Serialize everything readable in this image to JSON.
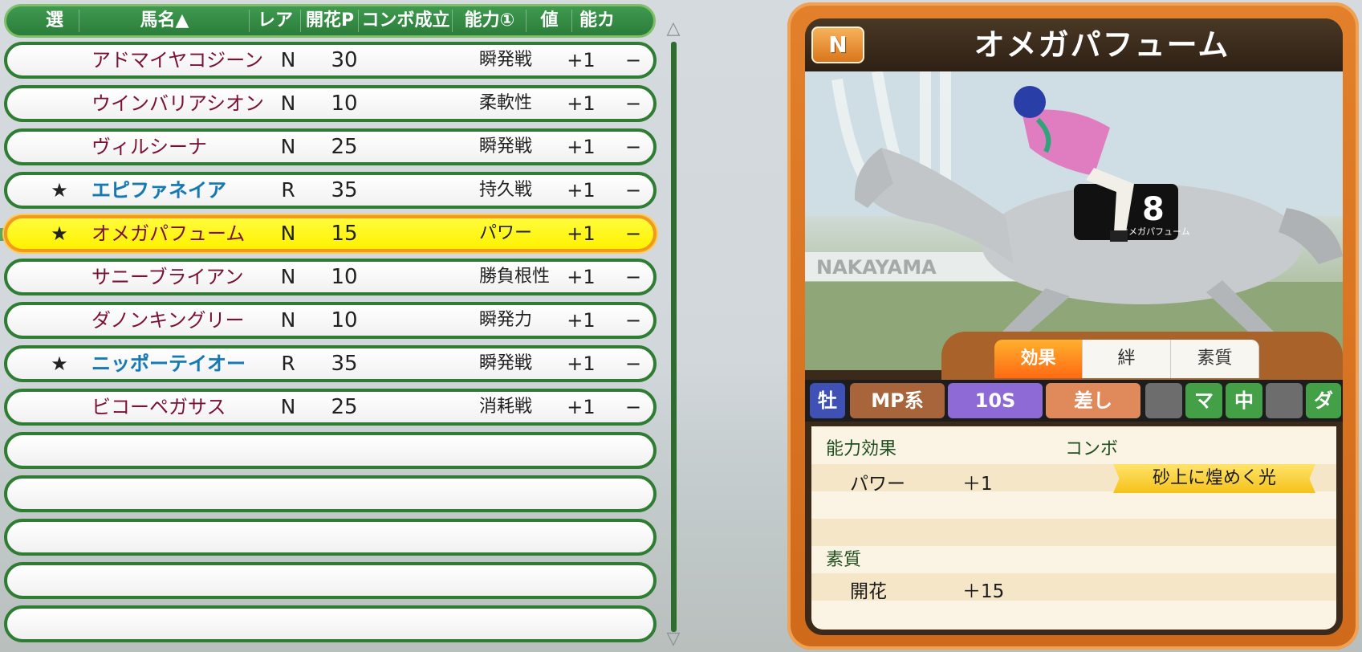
{
  "table": {
    "headers": [
      "選",
      "馬名▲",
      "レア",
      "開花P",
      "コンボ成立",
      "能力①",
      "値",
      "能カ"
    ],
    "rows": [
      {
        "star": "",
        "name": "アドマイヤコジーン",
        "rarity": "N",
        "points": "30",
        "ability": "瞬発戦",
        "value": "+1",
        "ability2": "−"
      },
      {
        "star": "",
        "name": "ウインバリアシオン",
        "rarity": "N",
        "points": "10",
        "ability": "柔軟性",
        "value": "+1",
        "ability2": "−"
      },
      {
        "star": "",
        "name": "ヴィルシーナ",
        "rarity": "N",
        "points": "25",
        "ability": "瞬発戦",
        "value": "+1",
        "ability2": "−"
      },
      {
        "star": "★",
        "name": "エピファネイア",
        "rarity": "R",
        "points": "35",
        "ability": "持久戦",
        "value": "+1",
        "ability2": "−"
      },
      {
        "star": "★",
        "name": "オメガパフューム",
        "rarity": "N",
        "points": "15",
        "ability": "パワー",
        "value": "+1",
        "ability2": "−"
      },
      {
        "star": "",
        "name": "サニーブライアン",
        "rarity": "N",
        "points": "10",
        "ability": "勝負根性",
        "value": "+1",
        "ability2": "−"
      },
      {
        "star": "",
        "name": "ダノンキングリー",
        "rarity": "N",
        "points": "10",
        "ability": "瞬発力",
        "value": "+1",
        "ability2": "−"
      },
      {
        "star": "★",
        "name": "ニッポーテイオー",
        "rarity": "R",
        "points": "35",
        "ability": "瞬発戦",
        "value": "+1",
        "ability2": "−"
      },
      {
        "star": "",
        "name": "ビコーペガサス",
        "rarity": "N",
        "points": "25",
        "ability": "消耗戦",
        "value": "+1",
        "ability2": "−"
      }
    ],
    "scroll_up": "△",
    "scroll_down": "▽"
  },
  "card": {
    "badge": "N",
    "title": "オメガパフューム",
    "photo": {
      "saddle_number": "8",
      "saddle_name": "オメガパフューム",
      "billboard": "NAKAYAMA"
    },
    "tabs": [
      "効果",
      "絆",
      "素質"
    ],
    "tags": [
      "牡",
      "MP系",
      "10S",
      "差し",
      "",
      "マ",
      "中",
      "",
      "ダ"
    ],
    "effect_label": "能力効果",
    "effect_name": "パワー",
    "effect_value": "＋1",
    "combo_label": "コンボ",
    "combo_value": "砂上に煌めく光",
    "trait_label": "素質",
    "trait_name": "開花",
    "trait_value": "＋15"
  },
  "colors": {
    "list_border": "#2e7d32",
    "selected_fill": "#fff200",
    "card_orange": "#e3802b"
  }
}
